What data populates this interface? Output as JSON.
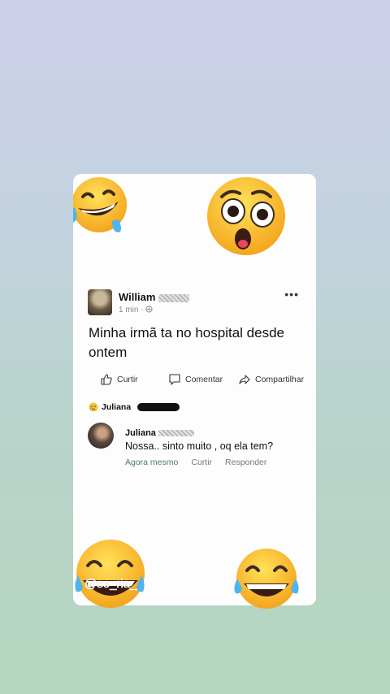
{
  "post": {
    "author": "William",
    "time": "1 min",
    "text": "Minha irmã ta no hospital desde ontem",
    "more_label": "•••"
  },
  "actions": {
    "like": "Curtir",
    "comment": "Comentar",
    "share": "Compartilhar"
  },
  "reaction": {
    "name": "Juliana"
  },
  "comment": {
    "author": "Juliana",
    "text": "Nossa.. sinto muito , oq ela tem?",
    "time": "Agora mesmo",
    "like": "Curtir",
    "reply": "Responder"
  },
  "watermark": "@so_ria_",
  "icons": [
    "laughing-crying-emoji",
    "shocked-emoji",
    "thumbs-up-icon",
    "comment-bubble-icon",
    "share-arrow-icon",
    "crying-emoji",
    "globe-icon"
  ],
  "colors": {
    "emoji_yellow": "#f7b92a",
    "card": "#fdfdfd"
  }
}
